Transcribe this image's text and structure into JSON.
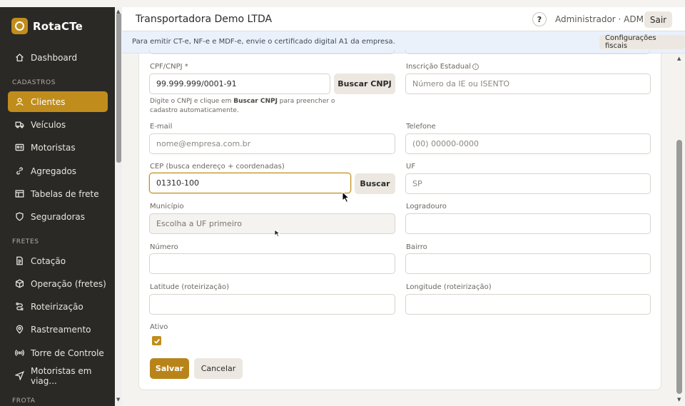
{
  "brand": {
    "name": "RotaCTe"
  },
  "sidebar": {
    "items_top": [
      {
        "label": "Dashboard",
        "icon": "home-icon"
      }
    ],
    "section_cadastros": "CADASTROS",
    "cadastros": [
      {
        "label": "Clientes",
        "icon": "user-icon",
        "active": true
      },
      {
        "label": "Veículos",
        "icon": "truck-icon"
      },
      {
        "label": "Motoristas",
        "icon": "id-card-icon"
      },
      {
        "label": "Agregados",
        "icon": "link-icon"
      },
      {
        "label": "Tabelas de frete",
        "icon": "table-icon"
      },
      {
        "label": "Seguradoras",
        "icon": "shield-icon"
      }
    ],
    "section_fretes": "FRETES",
    "fretes": [
      {
        "label": "Cotação",
        "icon": "document-icon"
      },
      {
        "label": "Operação (fretes)",
        "icon": "box-icon"
      },
      {
        "label": "Roteirização",
        "icon": "route-icon"
      },
      {
        "label": "Rastreamento",
        "icon": "pin-icon"
      },
      {
        "label": "Torre de Controle",
        "icon": "broadcast-icon"
      },
      {
        "label": "Motoristas em viag...",
        "icon": "navigation-icon"
      }
    ],
    "section_frota": "FROTA"
  },
  "header": {
    "title": "Transportadora Demo LTDA",
    "help": "?",
    "user": "Administrador · ADMIN",
    "logout": "Sair"
  },
  "banner": {
    "text": "Para emitir CT-e, NF-e e MDF-e, envie o certificado digital A1 da empresa.",
    "button": "Configurações fiscais"
  },
  "form": {
    "cnpj_label": "CPF/CNPJ *",
    "cnpj_value": "99.999.999/0001-91",
    "buscar_cnpj": "Buscar CNPJ",
    "cnpj_hint_1": "Digite o CNPJ e clique em ",
    "cnpj_hint_bold": "Buscar CNPJ",
    "cnpj_hint_2": " para preencher o cadastro automaticamente.",
    "ie_label": "Inscrição Estadual",
    "ie_placeholder": "Número da IE ou ISENTO",
    "email_label": "E-mail",
    "email_placeholder": "nome@empresa.com.br",
    "telefone_label": "Telefone",
    "telefone_placeholder": "(00) 00000-0000",
    "cep_label": "CEP (busca endereço + coordenadas)",
    "cep_value": "01310-100",
    "buscar": "Buscar",
    "uf_label": "UF",
    "uf_value": "SP",
    "municipio_label": "Município",
    "municipio_placeholder": "Escolha a UF primeiro",
    "logradouro_label": "Logradouro",
    "numero_label": "Número",
    "bairro_label": "Bairro",
    "latitude_label": "Latitude (roteirização)",
    "longitude_label": "Longitude (roteirização)",
    "ativo_label": "Ativo",
    "ativo_checked": true,
    "save": "Salvar",
    "cancel": "Cancelar"
  },
  "colors": {
    "accent": "#c08d1c",
    "sidebar": "#2b2926",
    "banner": "#eaf1fb"
  }
}
